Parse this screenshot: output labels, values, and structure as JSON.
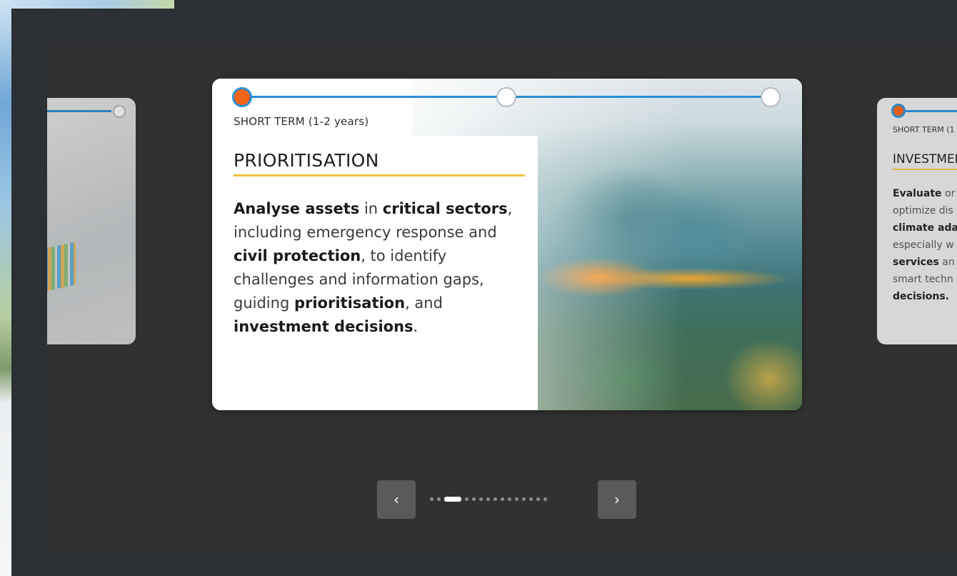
{
  "main_card": {
    "term": "SHORT TERM (1-2 years)",
    "heading": "PRIORITISATION",
    "body": [
      {
        "text": "Analyse assets",
        "bold": true
      },
      {
        "text": " in ",
        "bold": false
      },
      {
        "text": "critical sectors",
        "bold": true
      },
      {
        "text": ", including emergency response and ",
        "bold": false
      },
      {
        "text": "civil protection",
        "bold": true
      },
      {
        "text": ", to identify challenges and information gaps, guiding ",
        "bold": false
      },
      {
        "text": "prioritisation",
        "bold": true
      },
      {
        "text": ", and ",
        "bold": false
      },
      {
        "text": "investment decisions",
        "bold": true
      },
      {
        "text": ".",
        "bold": false
      }
    ]
  },
  "right_card": {
    "term": "SHORT TERM (1",
    "heading": "INVESTMEI",
    "lines": [
      [
        {
          "text": "Evaluate",
          "bold": true
        },
        {
          "text": " or",
          "bold": false
        }
      ],
      [
        {
          "text": "optimize dis",
          "bold": false
        }
      ],
      [
        {
          "text": "climate ada",
          "bold": true
        }
      ],
      [
        {
          "text": "especially w",
          "bold": false
        }
      ],
      [
        {
          "text": "services",
          "bold": true
        },
        {
          "text": " an",
          "bold": false
        }
      ],
      [
        {
          "text": "smart techn",
          "bold": false
        }
      ],
      [
        {
          "text": "decisions.",
          "bold": true
        }
      ]
    ]
  },
  "nav": {
    "prev_icon": "‹",
    "next_icon": "›",
    "dot_count": 15,
    "active_dot": 2
  },
  "colors": {
    "accent_blue": "#2b8fd6",
    "active_node": "#f06418",
    "underline_yellow": "#f0c23e"
  }
}
